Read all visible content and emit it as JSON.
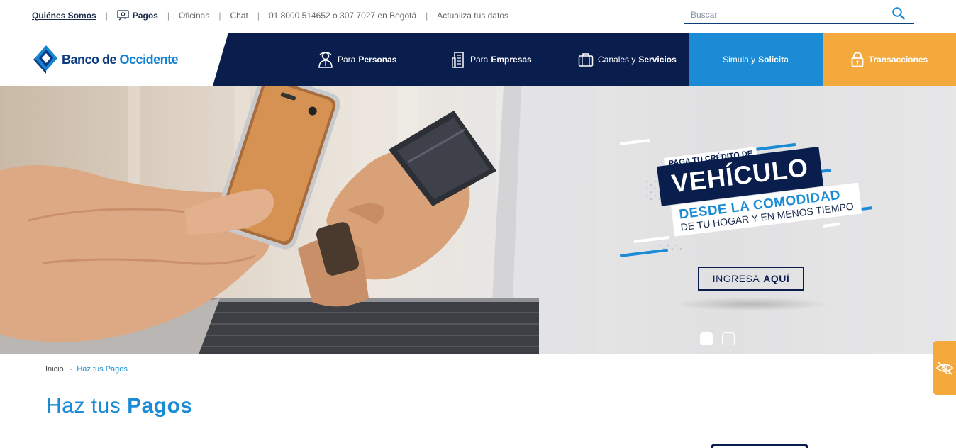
{
  "top_links": {
    "quienes": "Quiénes Somos",
    "pagos": "Pagos",
    "oficinas": "Oficinas",
    "chat": "Chat",
    "phone": "01 8000 514652 o 307 7027 en Bogotá",
    "actualiza": "Actualiza tus datos",
    "separator": "|"
  },
  "search": {
    "placeholder": "Buscar",
    "value": ""
  },
  "logo": {
    "part1": "Banco de",
    "part2": "Occidente"
  },
  "nav": {
    "personas": {
      "pre": "Para",
      "bold": "Personas"
    },
    "empresas": {
      "pre": "Para",
      "bold": "Empresas"
    },
    "canales": {
      "pre": "Canales y",
      "bold": "Servicios"
    },
    "simula": {
      "pre": "Simula y",
      "bold": "Solicita"
    },
    "transacciones": "Transacciones"
  },
  "hero": {
    "tag": "PAGA TU CRÉDITO DE",
    "title": "VEHÍCULO",
    "sub1": "DESDE LA COMODIDAD",
    "sub2": "DE TU HOGAR Y EN MENOS TIEMPO",
    "cta_pre": "INGRESA",
    "cta_bold": "AQUÍ",
    "slides": [
      {
        "active": true
      },
      {
        "active": false
      }
    ]
  },
  "breadcrumb": {
    "home": "Inicio",
    "sep": "-",
    "current": "Haz tus Pagos"
  },
  "page_title": {
    "light": "Haz tus",
    "bold": "Pagos"
  },
  "colors": {
    "navy": "#0a1e4e",
    "blue": "#1a8bd4",
    "orange": "#f4a93d",
    "logo_blue": "#0b3a82"
  },
  "icons": {
    "pagos": "payment-hand-icon",
    "search": "search-icon",
    "personas": "person-icon",
    "empresas": "building-icon",
    "canales": "briefcase-icon",
    "transacciones": "lock-icon",
    "accessibility": "eye-hand-icon"
  }
}
